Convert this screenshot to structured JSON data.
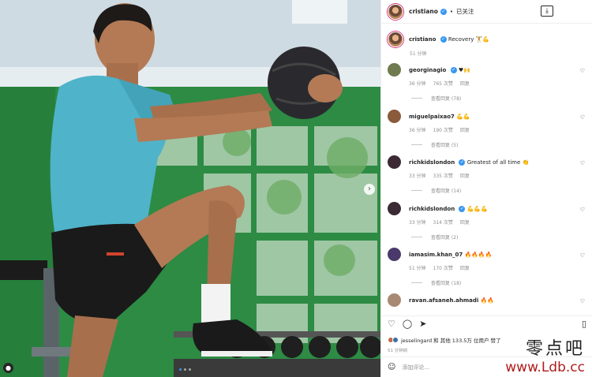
{
  "header": {
    "username": "cristiano",
    "separator": "•",
    "follow_label": "已关注",
    "download_icon": "download-icon"
  },
  "caption": {
    "username": "cristiano",
    "text": "Recovery 🏋💪",
    "time": "51 分钟"
  },
  "comments": [
    {
      "username": "georginagio",
      "text": "♥🙌",
      "time": "36 分钟",
      "likes": "765 次赞",
      "reply_label": "回复",
      "view_replies": "查看回复 (78)",
      "avatar_color": "#6f7a4e"
    },
    {
      "username": "miguelpaixao7",
      "text": "💪💪",
      "time": "36 分钟",
      "likes": "190 次赞",
      "reply_label": "回复",
      "view_replies": "查看回复 (5)",
      "avatar_color": "#8a5a3c"
    },
    {
      "username": "richkidslondon",
      "text": "Greatest of all time 👏",
      "time": "33 分钟",
      "likes": "335 次赞",
      "reply_label": "回复",
      "view_replies": "查看回复 (14)",
      "avatar_color": "#3b2a33"
    },
    {
      "username": "richkidslondon",
      "text": "💪💪💪",
      "time": "33 分钟",
      "likes": "314 次赞",
      "reply_label": "回复",
      "view_replies": "查看回复 (2)",
      "avatar_color": "#3b2a33"
    },
    {
      "username": "iamasim.khan_07",
      "text": "🔥🔥🔥🔥",
      "time": "51 分钟",
      "likes": "170 次赞",
      "reply_label": "回复",
      "view_replies": "查看回复 (18)",
      "avatar_color": "#4a3a6b"
    },
    {
      "username": "ravan.afsaneh.ahmadi",
      "text": "🔥🔥",
      "time": "",
      "likes": "",
      "reply_label": "",
      "view_replies": "",
      "avatar_color": "#a88a74"
    }
  ],
  "actions": {
    "like_icon": "heart-icon",
    "comment_icon": "comment-icon",
    "share_icon": "share-icon",
    "save_icon": "bookmark-icon"
  },
  "likes_line": "jesselingard 和 其他 133.5万 位用户 赞了",
  "post_time": "51 分钟前",
  "add_comment_placeholder": "添加评论...",
  "watermark": {
    "line1": "零点吧",
    "line2": "www.Ldb.cc"
  },
  "photo": {
    "next_icon": "chevron-right-icon",
    "tag_icon": "user-tag-icon",
    "carousel_dots": 3,
    "active_dot": 1
  },
  "colors": {
    "accent": "#3897f0",
    "shirt": "#4fb3c9",
    "window_frame": "#2f8f3f",
    "watermark": "#b01c1c"
  }
}
